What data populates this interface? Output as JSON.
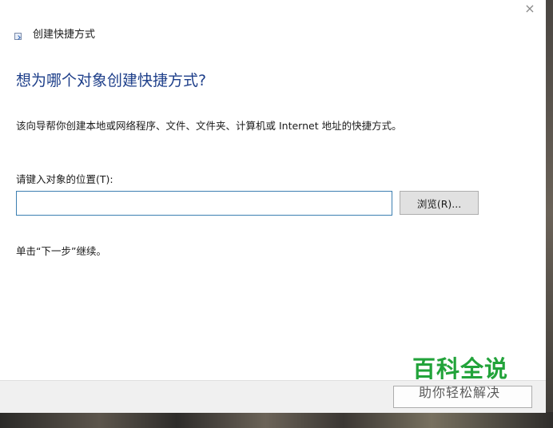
{
  "window": {
    "title": "创建快捷方式",
    "close_glyph": "×"
  },
  "main": {
    "heading": "想为哪个对象创建快捷方式?",
    "description": "该向导帮你创建本地或网络程序、文件、文件夹、计算机或 Internet 地址的快捷方式。",
    "location_label": "请键入对象的位置(T):",
    "location_value": "",
    "browse_label": "浏览(R)...",
    "hint": "单击“下一步”继续。"
  },
  "watermark": {
    "title": "百科全说",
    "subtitle": "助你轻松解决",
    "color": "#22a33a"
  },
  "icons": {
    "title_icon": "shortcut-icon",
    "close_icon": "close-icon"
  }
}
